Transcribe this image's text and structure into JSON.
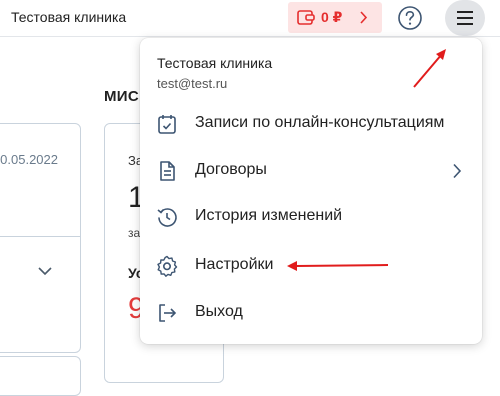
{
  "header": {
    "clinic_name": "Тестовая клиника",
    "balance": "0 ₽"
  },
  "background": {
    "heading": "МИС",
    "left_card_date": "0.05.2022",
    "main_card": {
      "small_text": "За",
      "big_value": "1",
      "small_text_2": "за",
      "bold_label": "Ус",
      "red_value": "9"
    }
  },
  "dropdown": {
    "clinic_name": "Тестовая клиника",
    "email": "test@test.ru",
    "items": [
      {
        "label": "Записи по онлайн-консультациям",
        "icon": "calendar-check-icon"
      },
      {
        "label": "Договоры",
        "icon": "document-icon"
      },
      {
        "label": "История изменений",
        "icon": "history-icon"
      },
      {
        "label": "Настройки",
        "icon": "gear-icon"
      },
      {
        "label": "Выход",
        "icon": "logout-icon"
      }
    ]
  },
  "colors": {
    "accent_red": "#e52e2e",
    "balance_bg": "#fde4e4",
    "icon_blue": "#3d5572",
    "annotation_red": "#e11c1c"
  }
}
